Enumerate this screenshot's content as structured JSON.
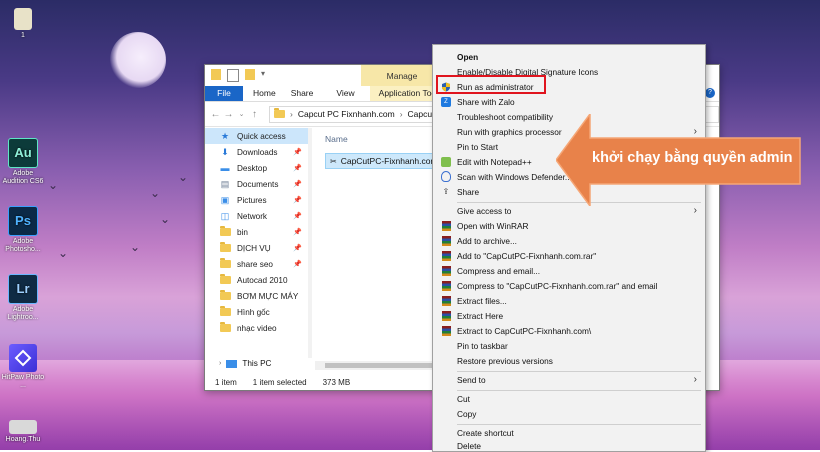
{
  "desktop": {
    "icons": [
      {
        "label": "1",
        "tile_text": "",
        "color": "#e8e2c8"
      },
      {
        "label": "Adobe Audition CS6",
        "tile_text": "Au",
        "color": "#0c3b3a"
      },
      {
        "label": "Adobe Photosho...",
        "tile_text": "Ps",
        "color": "#0b2a47"
      },
      {
        "label": "Adobe Lightroo...",
        "tile_text": "Lr",
        "color": "#0f2b44"
      },
      {
        "label": "HitPaw Photo ...",
        "tile_text": "",
        "color": "#4a3fd6"
      },
      {
        "label": "Hoang.Thu",
        "tile_text": "",
        "color": "#d9d9d9"
      }
    ]
  },
  "explorer": {
    "title_tab": "Manage",
    "ribbon_tabs": [
      "File",
      "Home",
      "Share",
      "View",
      "Application Tools"
    ],
    "breadcrumb": [
      "Capcut PC Fixnhanh.com",
      "Capcut"
    ],
    "column_header": "Name",
    "selected_file": "CapCutPC-Fixnhanh.com",
    "sidebar": [
      {
        "label": "Quick access",
        "icon": "star-icon",
        "pinned": false
      },
      {
        "label": "Downloads",
        "icon": "download-icon",
        "pinned": true
      },
      {
        "label": "Desktop",
        "icon": "desktop-icon",
        "pinned": true
      },
      {
        "label": "Documents",
        "icon": "documents-icon",
        "pinned": true
      },
      {
        "label": "Pictures",
        "icon": "pictures-icon",
        "pinned": true
      },
      {
        "label": "Network",
        "icon": "network-icon",
        "pinned": true
      },
      {
        "label": "bin",
        "icon": "folder-icon",
        "pinned": true
      },
      {
        "label": "DỊCH VỤ",
        "icon": "folder-icon",
        "pinned": true
      },
      {
        "label": "share seo",
        "icon": "folder-icon",
        "pinned": true
      },
      {
        "label": "Autocad 2010",
        "icon": "folder-icon",
        "pinned": false
      },
      {
        "label": "BƠM MỰC MÁY",
        "icon": "folder-icon",
        "pinned": false
      },
      {
        "label": "Hình gốc",
        "icon": "folder-icon",
        "pinned": false
      },
      {
        "label": "nhạc video",
        "icon": "folder-icon",
        "pinned": false
      }
    ],
    "this_pc": "This PC",
    "status": {
      "items": "1 item",
      "selected": "1 item selected",
      "size": "373 MB"
    }
  },
  "context_menu": {
    "items": [
      {
        "label": "Open",
        "bold": true,
        "icon": "",
        "arrow": false
      },
      {
        "label": "Enable/Disable Digital Signature Icons",
        "icon": "",
        "arrow": false
      },
      {
        "label": "Run as administrator",
        "icon": "shield-icon",
        "arrow": false
      },
      {
        "label": "Share with Zalo",
        "icon": "zalo-icon",
        "arrow": false
      },
      {
        "label": "Troubleshoot compatibility",
        "icon": "",
        "arrow": false
      },
      {
        "label": "Run with graphics processor",
        "icon": "",
        "arrow": true
      },
      {
        "label": "Pin to Start",
        "icon": "",
        "arrow": false
      },
      {
        "label": "Edit with Notepad++",
        "icon": "notepad-icon",
        "arrow": false
      },
      {
        "label": "Scan with Windows Defender...",
        "icon": "defender-icon",
        "arrow": false
      },
      {
        "label": "Share",
        "icon": "share-icon",
        "arrow": false
      },
      {
        "label": "Give access to",
        "icon": "",
        "arrow": true
      },
      {
        "label": "Open with WinRAR",
        "icon": "winrar-icon",
        "arrow": false
      },
      {
        "label": "Add to archive...",
        "icon": "winrar-icon",
        "arrow": false
      },
      {
        "label": "Add to \"CapCutPC-Fixnhanh.com.rar\"",
        "icon": "winrar-icon",
        "arrow": false
      },
      {
        "label": "Compress and email...",
        "icon": "winrar-icon",
        "arrow": false
      },
      {
        "label": "Compress to \"CapCutPC-Fixnhanh.com.rar\" and email",
        "icon": "winrar-icon",
        "arrow": false
      },
      {
        "label": "Extract files...",
        "icon": "winrar-icon",
        "arrow": false
      },
      {
        "label": "Extract Here",
        "icon": "winrar-icon",
        "arrow": false
      },
      {
        "label": "Extract to CapCutPC-Fixnhanh.com\\",
        "icon": "winrar-icon",
        "arrow": false
      },
      {
        "label": "Pin to taskbar",
        "icon": "",
        "arrow": false
      },
      {
        "label": "Restore previous versions",
        "icon": "",
        "arrow": false
      },
      {
        "label": "Send to",
        "icon": "",
        "arrow": true
      },
      {
        "label": "Cut",
        "icon": "",
        "arrow": false
      },
      {
        "label": "Copy",
        "icon": "",
        "arrow": false
      },
      {
        "label": "Create shortcut",
        "icon": "",
        "arrow": false
      },
      {
        "label": "Delete",
        "icon": "",
        "arrow": false
      }
    ]
  },
  "callout": {
    "text": "khởi chạy bằng quyền admin",
    "color": "#e8824a"
  },
  "colors": {
    "accent": "#1a66c7",
    "highlight": "#e0141e",
    "manage": "#f7e7a8"
  }
}
